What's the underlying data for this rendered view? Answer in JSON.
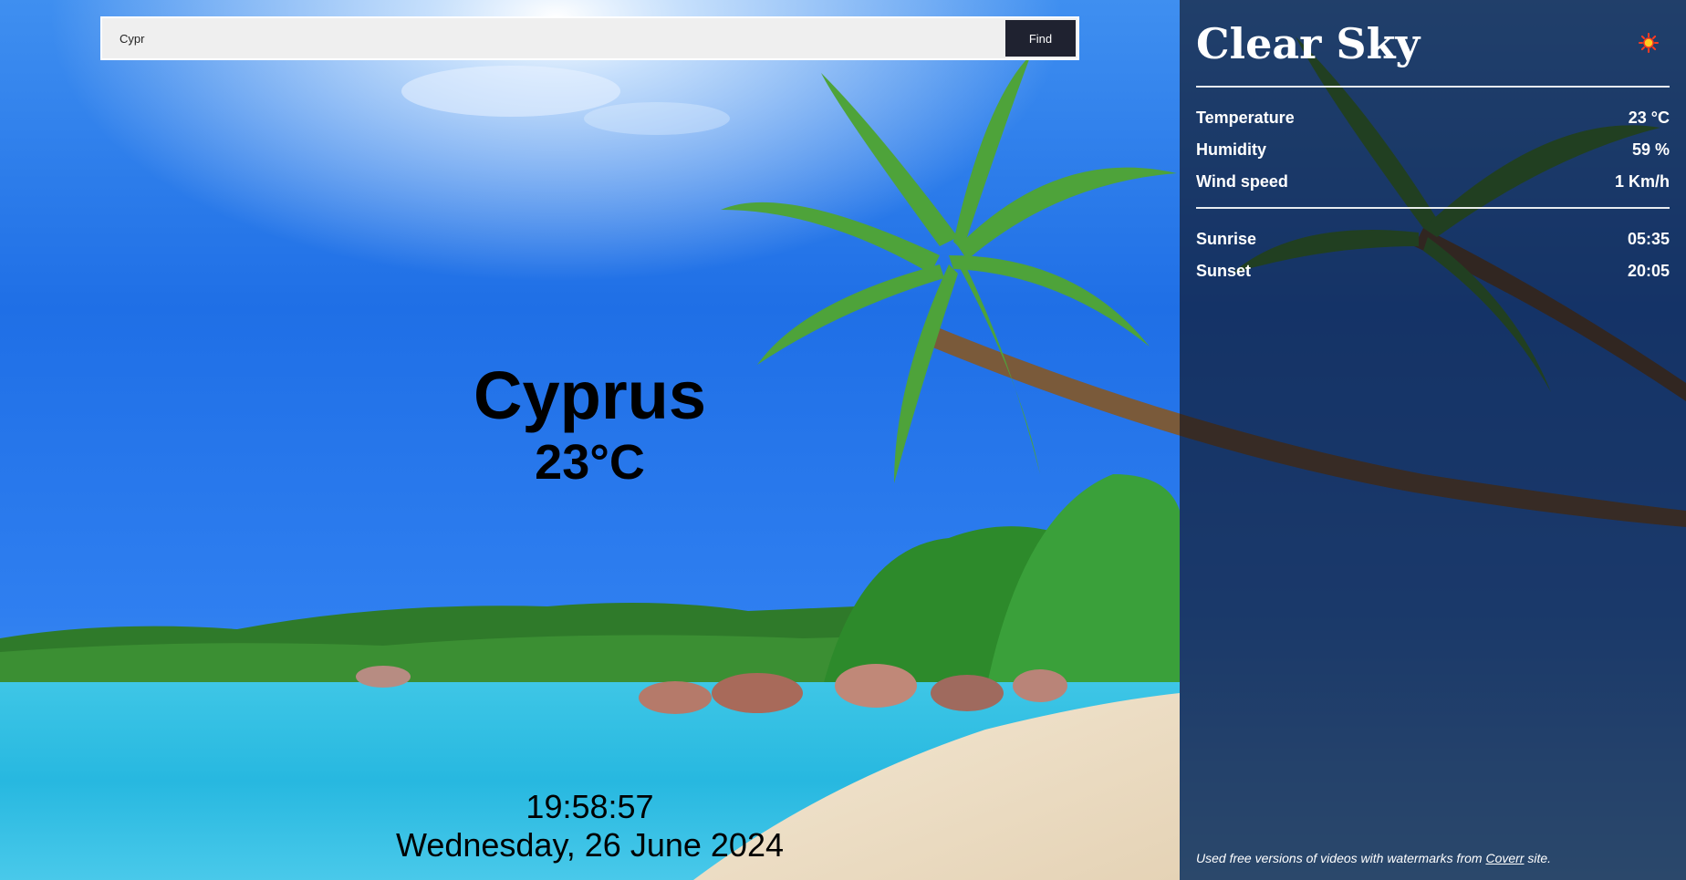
{
  "search": {
    "value": "Cypr",
    "button_label": "Find"
  },
  "location": {
    "city": "Cyprus",
    "temperature": "23°C"
  },
  "clock": {
    "time": "19:58:57",
    "date": "Wednesday, 26 June 2024"
  },
  "panel": {
    "condition": "Clear Sky",
    "icon": "sun-icon",
    "stats": [
      {
        "label": "Temperature",
        "value": "23 °C"
      },
      {
        "label": "Humidity",
        "value": "59 %"
      },
      {
        "label": "Wind speed",
        "value": "1 Km/h"
      }
    ],
    "sun": [
      {
        "label": "Sunrise",
        "value": "05:35"
      },
      {
        "label": "Sunset",
        "value": "20:05"
      }
    ],
    "footnote_prefix": "Used free versions of videos with watermarks from ",
    "footnote_link": "Coverr",
    "footnote_suffix": " site."
  },
  "colors": {
    "panel_overlay": "#0e0e18",
    "button_bg": "#1f2230",
    "sun_icon": "#ff3b1f"
  }
}
